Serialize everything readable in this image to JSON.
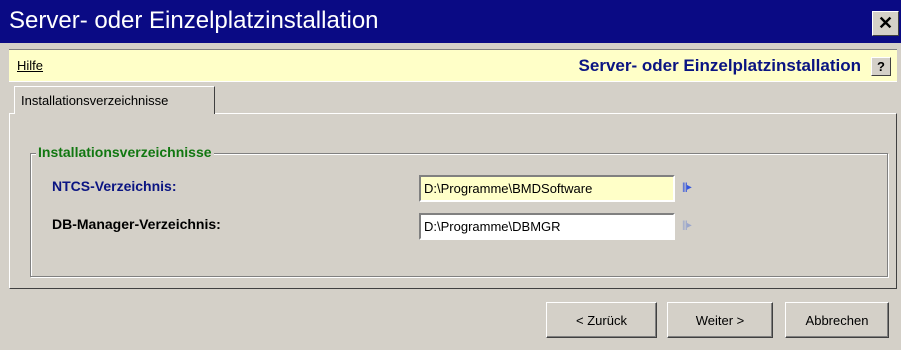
{
  "window": {
    "title": "Server- oder Einzelplatzinstallation"
  },
  "helpbar": {
    "menu_help": "Hilfe",
    "title": "Server- oder Einzelplatzinstallation",
    "help_button": "?"
  },
  "tab": {
    "label": "Installationsverzeichnisse"
  },
  "group": {
    "title": "Installationsverzeichnisse"
  },
  "fields": {
    "ntcs": {
      "label": "NTCS-Verzeichnis:",
      "value": "D:\\Programme\\BMDSoftware"
    },
    "dbmgr": {
      "label": "DB-Manager-Verzeichnis:",
      "value": "D:\\Programme\\DBMGR"
    }
  },
  "browse_icon": "browse-ellipsis-icon",
  "buttons": {
    "back": "< Zurück",
    "next": "Weiter >",
    "cancel": "Abbrechen"
  },
  "colors": {
    "titlebar": "#0a0a84",
    "helpbar": "#ffffc8",
    "group_title": "#117711",
    "label_blue": "#0a1482"
  }
}
